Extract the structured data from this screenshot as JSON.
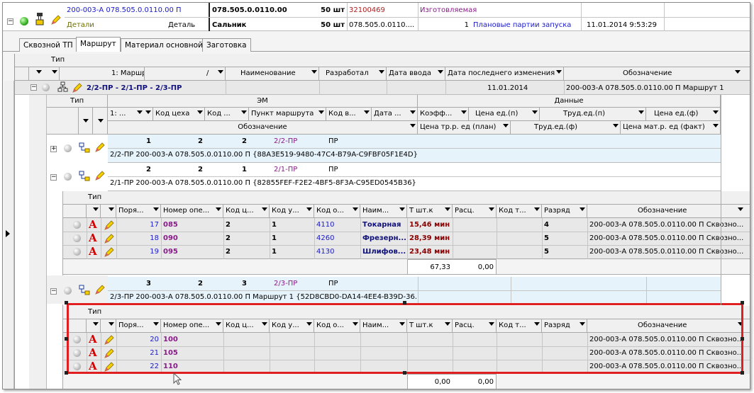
{
  "top_rows": {
    "r1": {
      "code": "200-003-А 078.505.0.0110.00 П",
      "designation": "078.505.0.0110.00",
      "qty": "50 шт",
      "number": "32100469",
      "type": "Изготовляемая"
    },
    "r2": {
      "category": "Детали",
      "kind": "Деталь",
      "name": "Сальник",
      "qty": "50 шт",
      "designation": "078.505.0.0110....",
      "count": "1",
      "plan": "Плановые партии запуска",
      "datetime": "11.01.2014 9:53:29"
    }
  },
  "tabs": [
    "Сквозной ТП",
    "Маршрут",
    "Материал основной",
    "Заготовка"
  ],
  "route_grid": {
    "type_label": "Тип",
    "columns": [
      "1: Маршрут",
      "/",
      "Наименование",
      "Разработал",
      "Дата ввода",
      "Дата последнего изменения",
      "Обозначение"
    ],
    "row": {
      "name": "2/2-ПР - 2/1-ПР - 2/3-ПР",
      "date": "11.01.2014",
      "designation": "200-003-А 078.505.0.0110.00 П Маршрут 1"
    }
  },
  "em_grid": {
    "type_label": "Тип",
    "group_em": "ЭМ",
    "group_data": "Данные",
    "columns": [
      "1: ...",
      "/",
      "Код цеха",
      "Код ...",
      "Пункт маршрута",
      "Код в...",
      "Дата ...",
      "Коэфф...",
      "Цена ед.(п)",
      "Труд.ед.(п)",
      "Цена ед.(ф)"
    ],
    "columns2": [
      "Обозначение",
      "Цена тр.р. ед (план)",
      "Труд.ед.(ф)",
      "Цена мат.р. ед (факт)"
    ],
    "rows": [
      {
        "n1": "1",
        "n2": "2",
        "n3": "2",
        "point": "2/2-ПР",
        "code": "ПР",
        "desc": "2/2-ПР 200-003-А 078.505.0.0110.00 П {88A3E519-9480-47C4-B79A-C9FBF05F1E4D}",
        "expanded": false
      },
      {
        "n1": "2",
        "n2": "2",
        "n3": "1",
        "point": "2/1-ПР",
        "code": "ПР",
        "desc": "2/1-ПР 200-003-А 078.505.0.0110.00 П {82855FEF-F2E2-4BF5-8F3A-C95ED0545B36}",
        "expanded": true
      },
      {
        "n1": "3",
        "n2": "2",
        "n3": "3",
        "point": "2/3-ПР",
        "code": "ПР",
        "desc": "2/3-ПР 200-003-А 078.505.0.0110.00 П Маршрут 1 {52D8CBD0-DA14-4EE4-B39D-36...",
        "expanded": true
      }
    ]
  },
  "ops_grid": {
    "type_label": "Тип",
    "columns": [
      "Поря...",
      "Номер опе...",
      "Код ц...",
      "Код у...",
      "Код о...",
      "Наим...",
      "Т шт.к",
      "Расц.",
      "Код т...",
      "Разряд",
      "Обозначение"
    ],
    "block1": {
      "rows": [
        {
          "order": "17",
          "num": "085",
          "shop": "2",
          "area": "1",
          "code": "4110",
          "name": "Токарная",
          "time": "15,46 мин",
          "grade": "4",
          "designation": "200-003-А 078.505.0.0110.00 П Сквозно..."
        },
        {
          "order": "18",
          "num": "090",
          "shop": "2",
          "area": "1",
          "code": "4260",
          "name": "Фрезерн...",
          "time": "28,39 мин",
          "grade": "5",
          "designation": "200-003-А 078.505.0.0110.00 П Сквозно..."
        },
        {
          "order": "19",
          "num": "095",
          "shop": "2",
          "area": "1",
          "code": "4130",
          "name": "Шлифов...",
          "time": "23,48 мин",
          "grade": "5",
          "designation": "200-003-А 078.505.0.0110.00 П Сквозно..."
        }
      ],
      "total_time": "67,33",
      "total_rate": "0,00"
    },
    "block2": {
      "rows": [
        {
          "order": "20",
          "num": "100",
          "designation": "200-003-А 078.505.0.0110.00 П Сквозно..."
        },
        {
          "order": "21",
          "num": "105",
          "designation": "200-003-А 078.505.0.0110.00 П Сквозно..."
        },
        {
          "order": "22",
          "num": "110",
          "designation": "200-003-А 078.505.0.0110.00 П Сквозно..."
        }
      ],
      "total_time": "0,00",
      "total_rate": "0,00"
    }
  },
  "colors": {
    "selection": "#e6f3fb",
    "highlight_box": "#e02020",
    "header": "#f0f0f0"
  }
}
